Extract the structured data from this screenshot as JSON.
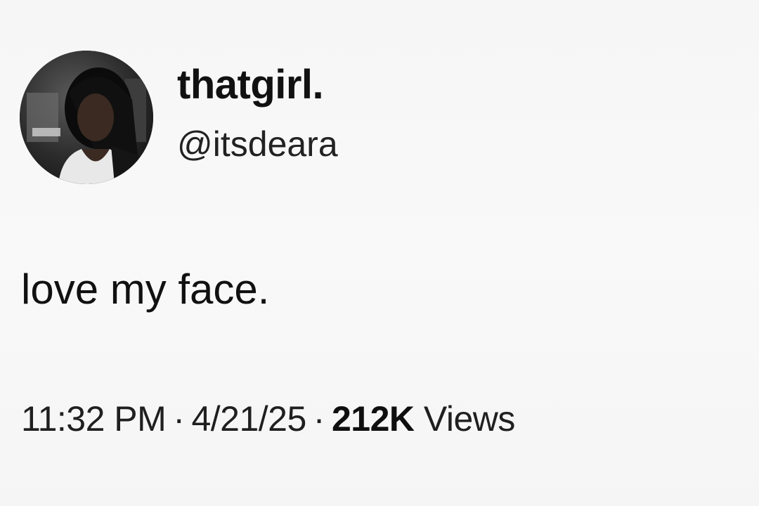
{
  "tweet": {
    "display_name": "thatgirl.",
    "handle": "@itsdeara",
    "text": "love my face.",
    "time": "11:32 PM",
    "date": "4/21/25",
    "separator": "·",
    "views_count": "212K",
    "views_label": "Views"
  },
  "colors": {
    "background": "#f7f7f7",
    "text": "#111111"
  }
}
